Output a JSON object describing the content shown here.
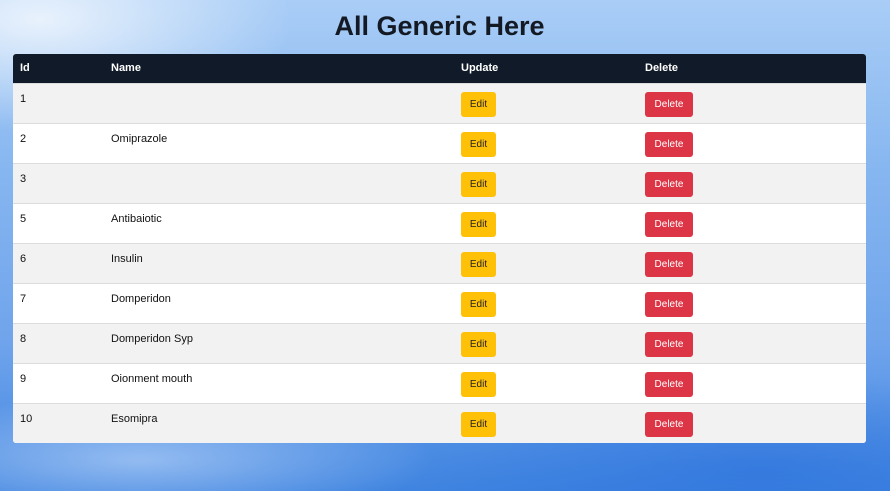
{
  "page": {
    "title": "All Generic Here"
  },
  "table": {
    "headers": {
      "id": "Id",
      "name": "Name",
      "update": "Update",
      "delete": "Delete"
    },
    "edit_label": "Edit",
    "delete_label": "Delete",
    "rows": [
      {
        "id": "1",
        "name": ""
      },
      {
        "id": "2",
        "name": "Omiprazole"
      },
      {
        "id": "3",
        "name": ""
      },
      {
        "id": "5",
        "name": "Antibaiotic"
      },
      {
        "id": "6",
        "name": "Insulin"
      },
      {
        "id": "7",
        "name": "Domperidon"
      },
      {
        "id": "8",
        "name": "Domperidon Syp"
      },
      {
        "id": "9",
        "name": "Oionment mouth"
      },
      {
        "id": "10",
        "name": "Esomipra"
      }
    ]
  },
  "colors": {
    "header_bg": "#111a28",
    "edit_button": "#ffc107",
    "delete_button": "#dc3545"
  }
}
